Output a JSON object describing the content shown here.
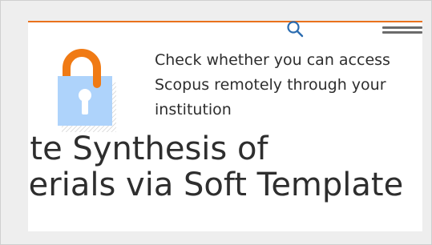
{
  "header": {
    "search_icon": "search-icon",
    "menu_icon": "hamburger-menu-icon",
    "accent_color": "#e9711c"
  },
  "article": {
    "title_line_1": "-site Synthesis of",
    "title_line_2": "terials via Soft Template"
  },
  "access_prompt": {
    "icon": "open-padlock-icon",
    "text": "Check whether you can access Scopus remotely through your institution",
    "lock_color": "#aed3fb",
    "shackle_color": "#f07a14"
  }
}
